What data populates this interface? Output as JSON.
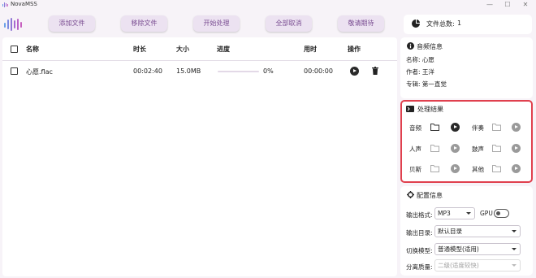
{
  "window": {
    "title": "NovaMSS",
    "controls": [
      "—",
      "☐",
      "✕"
    ]
  },
  "toolbar": {
    "buttons": [
      "添加文件",
      "移除文件",
      "开始处理",
      "全部取消",
      "敬请期待"
    ],
    "file_count_label": "文件总数:",
    "file_count_value": "1"
  },
  "table": {
    "headers": [
      "名称",
      "时长",
      "大小",
      "进度",
      "用时",
      "操作"
    ],
    "rows": [
      {
        "name": "心愿.flac",
        "duration": "00:02:40",
        "size": "15.0MB",
        "progress_text": "0%",
        "progress": 0,
        "elapsed": "00:00:00"
      }
    ]
  },
  "audio_info": {
    "title": "音频信息",
    "rows": [
      "名称:  心愿",
      "作者:  王洋",
      "专辑:  第一直觉"
    ]
  },
  "results": {
    "title": "处理结果",
    "items": [
      "音频",
      "伴奏",
      "人声",
      "鼓声",
      "贝斯",
      "其他"
    ]
  },
  "config": {
    "title": "配置信息",
    "format_label": "输出格式:",
    "format_value": "MP3",
    "gpu_label": "GPU",
    "dir_label": "输出目录:",
    "dir_value": "默认目录",
    "model_label": "切换模型:",
    "model_value": "普通模型(适用)",
    "quality_label": "分离质量:",
    "quality_value": "二级(适度较快)"
  },
  "colors": {
    "accent": "#7a4d92",
    "button_bg": "#ece2f1",
    "highlight": "#e0404e"
  }
}
